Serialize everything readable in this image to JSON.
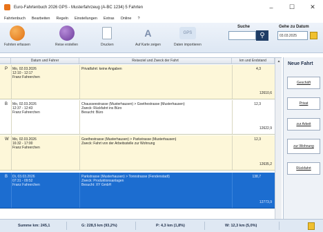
{
  "window": {
    "title": "Euro-Fahrtenbuch 2026 GPS - Musterfahrzeug (A-BC 1234) 5 Fahrten",
    "controls": {
      "minimize": "–",
      "maximize": "☐",
      "close": "✕"
    }
  },
  "menu": [
    "Fahrtenbuch",
    "Bearbeiten",
    "Regeln",
    "Einstellungen",
    "Extras",
    "Online",
    "?"
  ],
  "ribbon": {
    "buttons": [
      {
        "label": "Fahrten erfassen",
        "icon": "car-add-icon"
      },
      {
        "label": "Reise erstellen",
        "icon": "trip-icon"
      },
      {
        "label": "Drucken",
        "icon": "print-icon"
      },
      {
        "label": "Auf Karte zeigen",
        "icon": "map-icon"
      },
      {
        "label": "Daten importieren",
        "icon": "gps-import-icon"
      }
    ],
    "search": {
      "label": "Suche",
      "value": "",
      "placeholder": ""
    },
    "goto": {
      "label": "Gehe zu Datum",
      "value": "03.03.2025"
    }
  },
  "table": {
    "headers": [
      "Datum und Fahrer",
      "Reiseziel und Zweck der Fahrt",
      "km und Endstand"
    ],
    "rows": [
      {
        "type": "P",
        "date": "Mo, 02.03.2026",
        "time": "12:10 - 12:17",
        "driver": "Franz Fahrerchen",
        "route": "Privatfahrt: keine Angaben",
        "purpose": "",
        "contact": "",
        "km": "4,3",
        "odometer": "12610,6",
        "style": "yellow"
      },
      {
        "type": "B",
        "date": "Mo, 02.03.2026",
        "time": "12:37 - 12:43",
        "driver": "Franz Fahrerchen",
        "route": "Chausseestrasse (Musterhausen) > Goethestrasse (Musterhausen)",
        "purpose": "Zweck: Rückfahrt ins Büro",
        "contact": "Besucht: Büro",
        "km": "12,3",
        "odometer": "12622,9",
        "style": "white"
      },
      {
        "type": "W",
        "date": "Mo, 02.03.2026",
        "time": "16:32 - 17:00",
        "driver": "Franz Fahrerchen",
        "route": "Goethestrasse (Musterhausen) > Parkstrasse (Musterhausen)",
        "purpose": "Zweck: Fahrt von der Arbeitsstelle zur Wohnung",
        "contact": "",
        "km": "12,3",
        "odometer": "12635,2",
        "style": "yellow"
      },
      {
        "type": "B",
        "date": "Di, 03.03.2026",
        "time": "07:31 - 09:52",
        "driver": "Franz Fahrerchen",
        "route": "Parkstrasse (Musterhausen) > Tonnstrasse (Fendenstadt)",
        "purpose": "Zweck: Produktionsanlagen",
        "contact": "Besucht: XY GmbH",
        "km": "138,7",
        "odometer": "12773,9",
        "style": "blue"
      }
    ]
  },
  "sidepanel": {
    "title": "Neue Fahrt",
    "buttons": [
      "Geschäft",
      "Privat",
      "zur Arbeit",
      "zur Wohnung",
      "Rückfahrt"
    ]
  },
  "status": {
    "total": "Summe km: 245,1",
    "business": "G: 228,5 km (93,2%)",
    "private": "P: 4,3 km (1,8%)",
    "commute": "W: 12,3 km (5,0%)"
  }
}
